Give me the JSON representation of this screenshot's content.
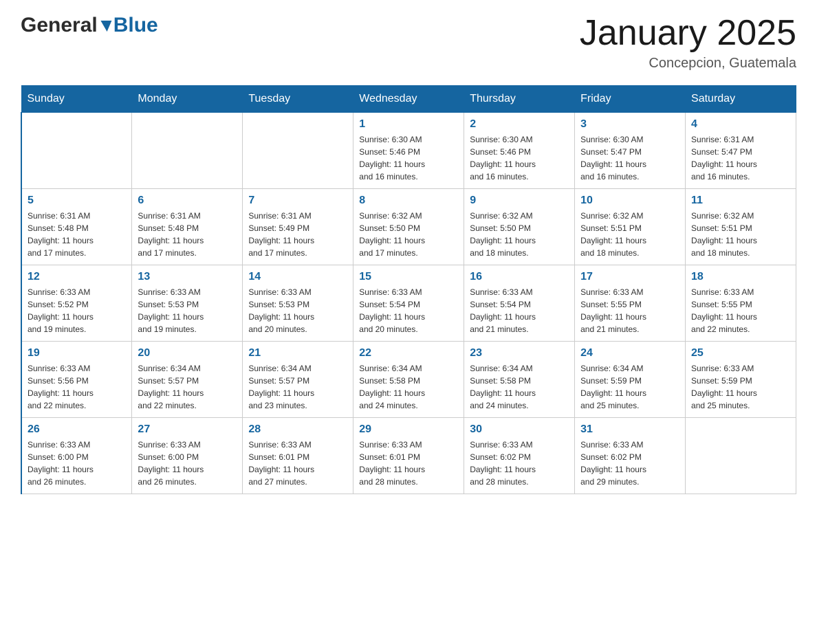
{
  "header": {
    "logo": {
      "general": "General",
      "blue": "Blue"
    },
    "title": "January 2025",
    "location": "Concepcion, Guatemala"
  },
  "calendar": {
    "days_of_week": [
      "Sunday",
      "Monday",
      "Tuesday",
      "Wednesday",
      "Thursday",
      "Friday",
      "Saturday"
    ],
    "weeks": [
      [
        {
          "day": "",
          "info": ""
        },
        {
          "day": "",
          "info": ""
        },
        {
          "day": "",
          "info": ""
        },
        {
          "day": "1",
          "info": "Sunrise: 6:30 AM\nSunset: 5:46 PM\nDaylight: 11 hours\nand 16 minutes."
        },
        {
          "day": "2",
          "info": "Sunrise: 6:30 AM\nSunset: 5:46 PM\nDaylight: 11 hours\nand 16 minutes."
        },
        {
          "day": "3",
          "info": "Sunrise: 6:30 AM\nSunset: 5:47 PM\nDaylight: 11 hours\nand 16 minutes."
        },
        {
          "day": "4",
          "info": "Sunrise: 6:31 AM\nSunset: 5:47 PM\nDaylight: 11 hours\nand 16 minutes."
        }
      ],
      [
        {
          "day": "5",
          "info": "Sunrise: 6:31 AM\nSunset: 5:48 PM\nDaylight: 11 hours\nand 17 minutes."
        },
        {
          "day": "6",
          "info": "Sunrise: 6:31 AM\nSunset: 5:48 PM\nDaylight: 11 hours\nand 17 minutes."
        },
        {
          "day": "7",
          "info": "Sunrise: 6:31 AM\nSunset: 5:49 PM\nDaylight: 11 hours\nand 17 minutes."
        },
        {
          "day": "8",
          "info": "Sunrise: 6:32 AM\nSunset: 5:50 PM\nDaylight: 11 hours\nand 17 minutes."
        },
        {
          "day": "9",
          "info": "Sunrise: 6:32 AM\nSunset: 5:50 PM\nDaylight: 11 hours\nand 18 minutes."
        },
        {
          "day": "10",
          "info": "Sunrise: 6:32 AM\nSunset: 5:51 PM\nDaylight: 11 hours\nand 18 minutes."
        },
        {
          "day": "11",
          "info": "Sunrise: 6:32 AM\nSunset: 5:51 PM\nDaylight: 11 hours\nand 18 minutes."
        }
      ],
      [
        {
          "day": "12",
          "info": "Sunrise: 6:33 AM\nSunset: 5:52 PM\nDaylight: 11 hours\nand 19 minutes."
        },
        {
          "day": "13",
          "info": "Sunrise: 6:33 AM\nSunset: 5:53 PM\nDaylight: 11 hours\nand 19 minutes."
        },
        {
          "day": "14",
          "info": "Sunrise: 6:33 AM\nSunset: 5:53 PM\nDaylight: 11 hours\nand 20 minutes."
        },
        {
          "day": "15",
          "info": "Sunrise: 6:33 AM\nSunset: 5:54 PM\nDaylight: 11 hours\nand 20 minutes."
        },
        {
          "day": "16",
          "info": "Sunrise: 6:33 AM\nSunset: 5:54 PM\nDaylight: 11 hours\nand 21 minutes."
        },
        {
          "day": "17",
          "info": "Sunrise: 6:33 AM\nSunset: 5:55 PM\nDaylight: 11 hours\nand 21 minutes."
        },
        {
          "day": "18",
          "info": "Sunrise: 6:33 AM\nSunset: 5:55 PM\nDaylight: 11 hours\nand 22 minutes."
        }
      ],
      [
        {
          "day": "19",
          "info": "Sunrise: 6:33 AM\nSunset: 5:56 PM\nDaylight: 11 hours\nand 22 minutes."
        },
        {
          "day": "20",
          "info": "Sunrise: 6:34 AM\nSunset: 5:57 PM\nDaylight: 11 hours\nand 22 minutes."
        },
        {
          "day": "21",
          "info": "Sunrise: 6:34 AM\nSunset: 5:57 PM\nDaylight: 11 hours\nand 23 minutes."
        },
        {
          "day": "22",
          "info": "Sunrise: 6:34 AM\nSunset: 5:58 PM\nDaylight: 11 hours\nand 24 minutes."
        },
        {
          "day": "23",
          "info": "Sunrise: 6:34 AM\nSunset: 5:58 PM\nDaylight: 11 hours\nand 24 minutes."
        },
        {
          "day": "24",
          "info": "Sunrise: 6:34 AM\nSunset: 5:59 PM\nDaylight: 11 hours\nand 25 minutes."
        },
        {
          "day": "25",
          "info": "Sunrise: 6:33 AM\nSunset: 5:59 PM\nDaylight: 11 hours\nand 25 minutes."
        }
      ],
      [
        {
          "day": "26",
          "info": "Sunrise: 6:33 AM\nSunset: 6:00 PM\nDaylight: 11 hours\nand 26 minutes."
        },
        {
          "day": "27",
          "info": "Sunrise: 6:33 AM\nSunset: 6:00 PM\nDaylight: 11 hours\nand 26 minutes."
        },
        {
          "day": "28",
          "info": "Sunrise: 6:33 AM\nSunset: 6:01 PM\nDaylight: 11 hours\nand 27 minutes."
        },
        {
          "day": "29",
          "info": "Sunrise: 6:33 AM\nSunset: 6:01 PM\nDaylight: 11 hours\nand 28 minutes."
        },
        {
          "day": "30",
          "info": "Sunrise: 6:33 AM\nSunset: 6:02 PM\nDaylight: 11 hours\nand 28 minutes."
        },
        {
          "day": "31",
          "info": "Sunrise: 6:33 AM\nSunset: 6:02 PM\nDaylight: 11 hours\nand 29 minutes."
        },
        {
          "day": "",
          "info": ""
        }
      ]
    ]
  }
}
